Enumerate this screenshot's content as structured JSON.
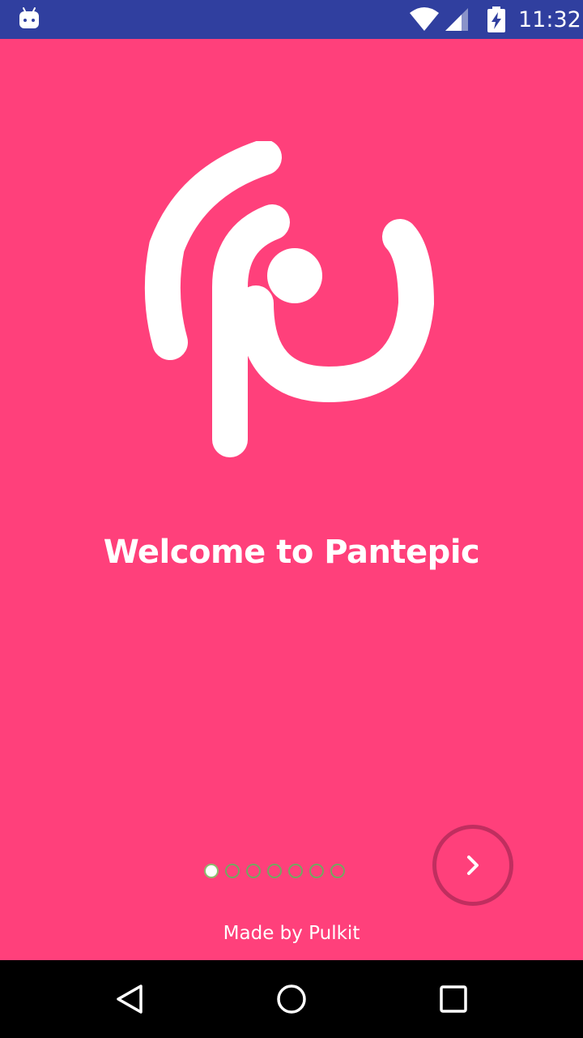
{
  "status_bar": {
    "time": "11:32",
    "icons": [
      "android-icon",
      "wifi-icon",
      "cell-signal-icon",
      "battery-charging-icon"
    ],
    "background": "#303f9f"
  },
  "onboarding": {
    "title": "Welcome to Pantepic",
    "background": "#ff407b",
    "logo_icon": "pantepic-logo",
    "page_indicator": {
      "total": 7,
      "current": 1
    },
    "next_button_icon": "chevron-right-icon",
    "footer": "Made by Pulkit"
  },
  "nav_bar": {
    "icons": [
      "back-icon",
      "home-icon",
      "recents-icon"
    ]
  }
}
